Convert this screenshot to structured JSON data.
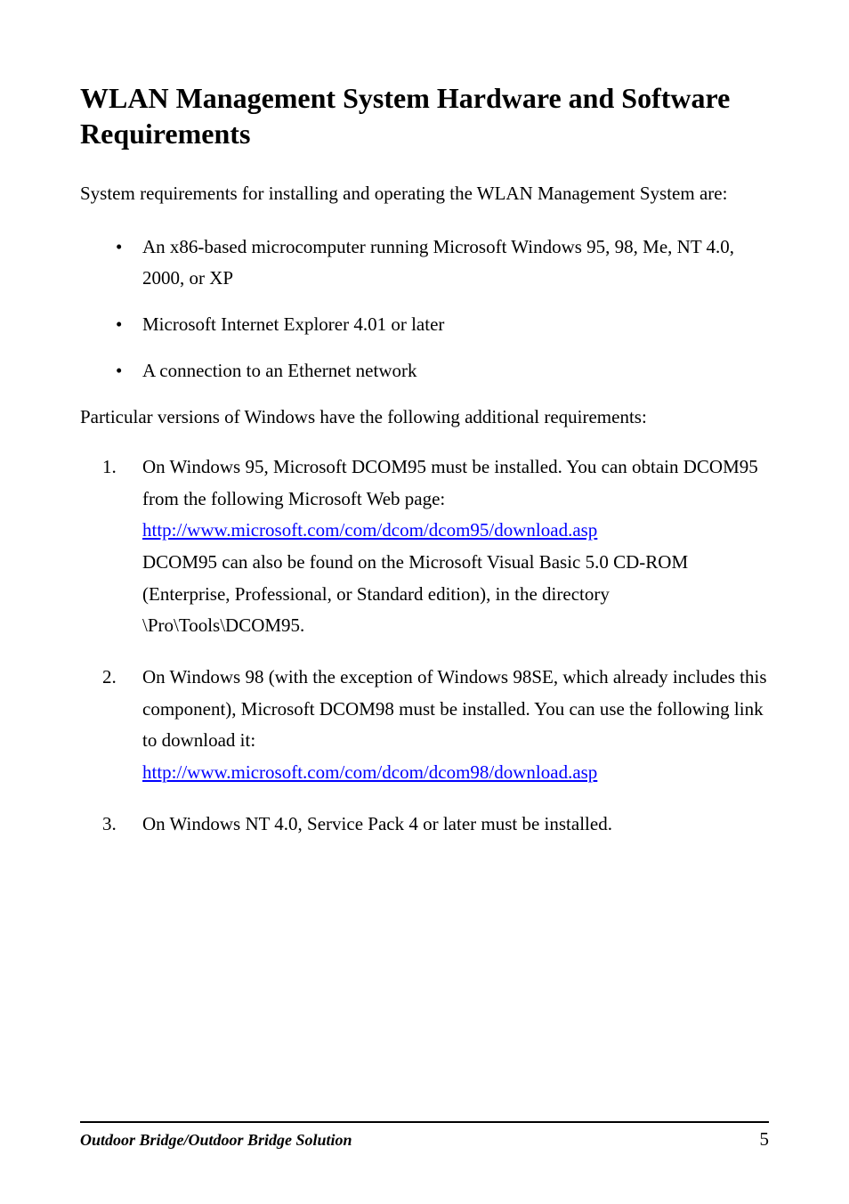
{
  "title": "WLAN Management System Hardware and Software Requirements",
  "intro": "System requirements for installing and operating the WLAN Management System are:",
  "bullets": [
    "An x86-based microcomputer running Microsoft Windows 95, 98, Me, NT 4.0, 2000, or XP",
    "Microsoft Internet Explorer 4.01 or later",
    "A connection to an Ethernet network"
  ],
  "mid": "Particular versions of Windows have the following additional requirements:",
  "ol1": {
    "pre": "On Windows 95, Microsoft DCOM95 must be installed. You can obtain DCOM95 from the following Microsoft Web page: ",
    "link": "http://www.microsoft.com/com/dcom/dcom95/download.asp",
    "post": "DCOM95 can also be found on the Microsoft Visual Basic 5.0 CD-ROM (Enterprise, Professional, or Standard edition), in the directory \\Pro\\Tools\\DCOM95."
  },
  "ol2": {
    "pre": "On Windows 98 (with the exception of Windows 98SE, which already includes this component), Microsoft DCOM98 must be installed. You can use the following link to download it:",
    "link": "http://www.microsoft.com/com/dcom/dcom98/download.asp"
  },
  "ol3": "On Windows NT 4.0, Service Pack 4 or later must be installed.",
  "footer": {
    "left": "Outdoor Bridge/Outdoor Bridge Solution",
    "page": "5"
  }
}
